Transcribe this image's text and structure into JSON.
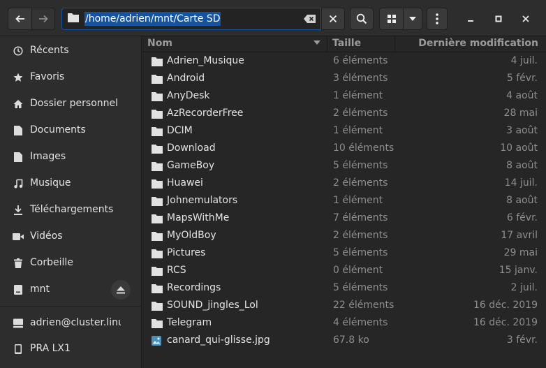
{
  "header": {
    "path": "/home/adrien/mnt/Carte SD"
  },
  "sidebar": {
    "items": [
      {
        "label": "Récents",
        "icon": "clock-icon"
      },
      {
        "label": "Favoris",
        "icon": "star-icon"
      },
      {
        "label": "Dossier personnel",
        "icon": "home-icon"
      },
      {
        "label": "Documents",
        "icon": "document-icon"
      },
      {
        "label": "Images",
        "icon": "image-icon"
      },
      {
        "label": "Musique",
        "icon": "music-icon"
      },
      {
        "label": "Téléchargements",
        "icon": "download-icon"
      },
      {
        "label": "Vidéos",
        "icon": "video-icon"
      },
      {
        "label": "Corbeille",
        "icon": "trash-icon"
      },
      {
        "label": "mnt",
        "icon": "drive-icon"
      },
      {
        "label": "adrien@cluster.linu...",
        "icon": "network-icon"
      },
      {
        "label": "PRA LX1",
        "icon": "phone-icon"
      }
    ]
  },
  "columns": {
    "name": "Nom",
    "size": "Taille",
    "date": "Dernière modification"
  },
  "files": [
    {
      "name": "Adrien_Musique",
      "size": "6 éléments",
      "date": "4 juil.",
      "type": "folder"
    },
    {
      "name": "Android",
      "size": "3 éléments",
      "date": "5 févr.",
      "type": "folder"
    },
    {
      "name": "AnyDesk",
      "size": "1 élément",
      "date": "4 août",
      "type": "folder"
    },
    {
      "name": "AzRecorderFree",
      "size": "2 éléments",
      "date": "28 mai",
      "type": "folder"
    },
    {
      "name": "DCIM",
      "size": "1 élément",
      "date": "3 août",
      "type": "folder"
    },
    {
      "name": "Download",
      "size": "10 éléments",
      "date": "10 août",
      "type": "folder"
    },
    {
      "name": "GameBoy",
      "size": "5 éléments",
      "date": "8 août",
      "type": "folder"
    },
    {
      "name": "Huawei",
      "size": "2 éléments",
      "date": "14 juil.",
      "type": "folder"
    },
    {
      "name": "Johnemulators",
      "size": "1 élément",
      "date": "8 août",
      "type": "folder"
    },
    {
      "name": "MapsWithMe",
      "size": "7 éléments",
      "date": "6 févr.",
      "type": "folder"
    },
    {
      "name": "MyOldBoy",
      "size": "2 éléments",
      "date": "17 avril",
      "type": "folder"
    },
    {
      "name": "Pictures",
      "size": "5 éléments",
      "date": "29 mai",
      "type": "folder"
    },
    {
      "name": "RCS",
      "size": "0 élément",
      "date": "15 janv.",
      "type": "folder"
    },
    {
      "name": "Recordings",
      "size": "5 éléments",
      "date": "2 juil.",
      "type": "folder"
    },
    {
      "name": "SOUND_jingles_Lol",
      "size": "22 éléments",
      "date": "16 déc. 2019",
      "type": "folder"
    },
    {
      "name": "Telegram",
      "size": "4 éléments",
      "date": "16 déc. 2019",
      "type": "folder"
    },
    {
      "name": "canard_qui-glisse.jpg",
      "size": "67.8 ko",
      "date": "3 févr.",
      "type": "image"
    }
  ],
  "colors": {
    "accent": "#15539e",
    "headerbar": "#2d2d2d",
    "sidebar": "#2d2d2d",
    "list_bg": "#262626"
  }
}
